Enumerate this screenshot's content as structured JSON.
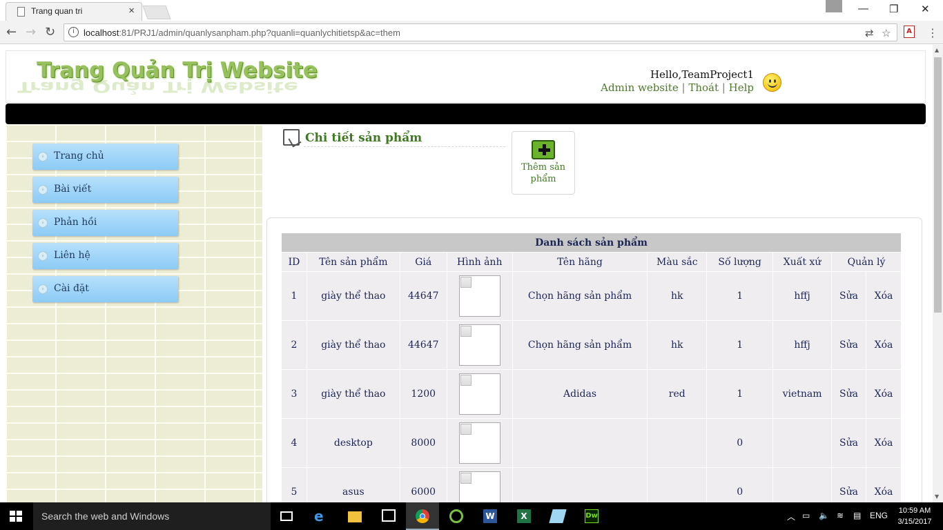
{
  "browser": {
    "tab_title": "Trang quan tri",
    "tab_close": "×",
    "url_host": "localhost",
    "url_rest": ":81/PRJ1/admin/quanlysanpham.php?quanli=quanlychitietsp&ac=them",
    "window_minimize": "—",
    "window_restore": "❐",
    "window_close": "✕",
    "back": "←",
    "forward": "→",
    "reload": "↻",
    "star": "☆",
    "translate": "⇄",
    "menu": "⋮"
  },
  "header": {
    "logo_text": "Trang Quản Trị Website",
    "hello": "Hello,TeamProject1",
    "links": [
      {
        "label": "Admin website"
      },
      {
        "label": "Thoát"
      },
      {
        "label": "Help"
      }
    ],
    "separator": "|"
  },
  "sidebar": {
    "items": [
      {
        "label": "Trang chủ"
      },
      {
        "label": "Bài viết"
      },
      {
        "label": "Phản hồi"
      },
      {
        "label": "Liên hệ"
      },
      {
        "label": "Cài đặt"
      }
    ]
  },
  "main": {
    "section_title": "Chi tiết sản phẩm",
    "add_button_label_1": "Thêm sản",
    "add_button_label_2": "phẩm",
    "table": {
      "caption": "Danh sách sản phẩm",
      "columns": [
        "ID",
        "Tên sản phẩm",
        "Giá",
        "Hình ảnh",
        "Tên hãng",
        "Màu sắc",
        "Số lượng",
        "Xuất xứ",
        "Quản lý"
      ],
      "edit_label": "Sửa",
      "delete_label": "Xóa",
      "rows": [
        {
          "id": "1",
          "name": "giày thể thao",
          "price": "44647",
          "brand": "Chọn hãng sản phẩm",
          "color": "hk",
          "qty": "1",
          "origin": "hffj"
        },
        {
          "id": "2",
          "name": "giày thể thao",
          "price": "44647",
          "brand": "Chọn hãng sản phẩm",
          "color": "hk",
          "qty": "1",
          "origin": "hffj"
        },
        {
          "id": "3",
          "name": "giày thể thao",
          "price": "1200",
          "brand": "Adidas",
          "color": "red",
          "qty": "1",
          "origin": "vietnam"
        },
        {
          "id": "4",
          "name": "desktop",
          "price": "8000",
          "brand": "",
          "color": "",
          "qty": "0",
          "origin": ""
        },
        {
          "id": "5",
          "name": "asus",
          "price": "6000",
          "brand": "",
          "color": "",
          "qty": "0",
          "origin": ""
        }
      ]
    }
  },
  "taskbar": {
    "search_placeholder": "Search the web and Windows",
    "language": "ENG",
    "time": "10:59 AM",
    "date": "3/15/2017",
    "apps": [
      "task-view",
      "edge",
      "file-explorer",
      "store",
      "chrome",
      "coccoc",
      "word",
      "excel",
      "photos",
      "dreamweaver"
    ]
  },
  "colors": {
    "accent_green": "#3f7a22",
    "menu_blue": "#8ccbf6",
    "table_text": "#1b2555",
    "header_bar": "#000000"
  }
}
